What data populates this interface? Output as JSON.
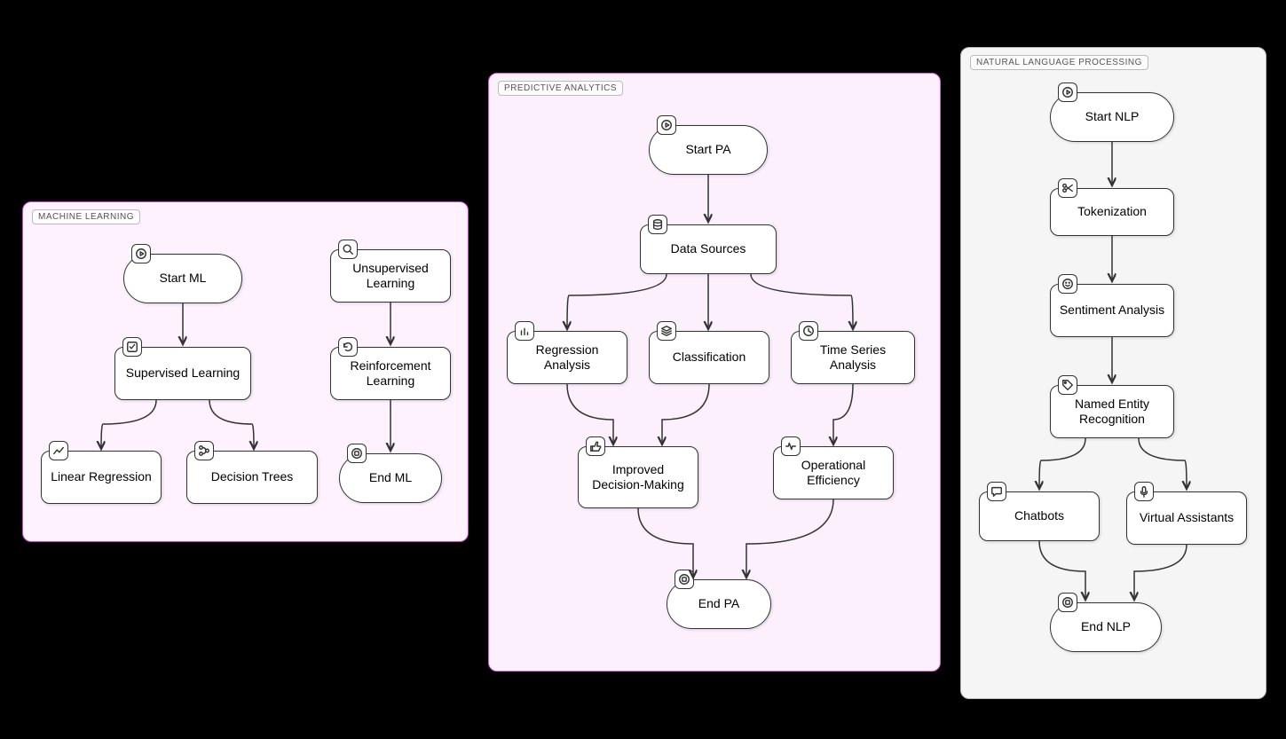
{
  "groups": {
    "ml": {
      "label": "MACHINE LEARNING"
    },
    "pa": {
      "label": "PREDICTIVE ANALYTICS"
    },
    "nlp": {
      "label": "NATURAL LANGUAGE PROCESSING"
    }
  },
  "nodes": {
    "ml_start": "Start ML",
    "ml_supervised": "Supervised Learning",
    "ml_unsupervised": "Unsupervised Learning",
    "ml_reinforcement": "Reinforcement Learning",
    "ml_linreg": "Linear Regression",
    "ml_dtrees": "Decision Trees",
    "ml_end": "End ML",
    "pa_start": "Start PA",
    "pa_sources": "Data Sources",
    "pa_regression": "Regression Analysis",
    "pa_classification": "Classification",
    "pa_timeseries": "Time Series Analysis",
    "pa_decision": "Improved Decision-Making",
    "pa_efficiency": "Operational Efficiency",
    "pa_end": "End PA",
    "nlp_start": "Start NLP",
    "nlp_token": "Tokenization",
    "nlp_sentiment": "Sentiment Analysis",
    "nlp_ner": "Named Entity Recognition",
    "nlp_chatbots": "Chatbots",
    "nlp_va": "Virtual Assistants",
    "nlp_end": "End NLP"
  },
  "icons": {
    "play": "play-icon",
    "stop": "stop-icon",
    "check": "check-icon",
    "search": "search-icon",
    "refresh": "refresh-icon",
    "chart": "chart-icon",
    "branch": "branch-icon",
    "db": "db-icon",
    "bars": "bars-icon",
    "layers": "layers-icon",
    "clock": "clock-icon",
    "thumbs": "thumbs-icon",
    "pulse": "pulse-icon",
    "scissors": "scissors-icon",
    "smile": "smile-icon",
    "tag": "tag-icon",
    "chat": "chat-icon",
    "mic": "mic-icon"
  },
  "diagram": {
    "groups": [
      {
        "id": "ml",
        "nodes": [
          "ml_start",
          "ml_supervised",
          "ml_unsupervised",
          "ml_reinforcement",
          "ml_linreg",
          "ml_dtrees",
          "ml_end"
        ]
      },
      {
        "id": "pa",
        "nodes": [
          "pa_start",
          "pa_sources",
          "pa_regression",
          "pa_classification",
          "pa_timeseries",
          "pa_decision",
          "pa_efficiency",
          "pa_end"
        ]
      },
      {
        "id": "nlp",
        "nodes": [
          "nlp_start",
          "nlp_token",
          "nlp_sentiment",
          "nlp_ner",
          "nlp_chatbots",
          "nlp_va",
          "nlp_end"
        ]
      }
    ],
    "edges": [
      [
        "ml_start",
        "ml_supervised"
      ],
      [
        "ml_supervised",
        "ml_linreg"
      ],
      [
        "ml_supervised",
        "ml_dtrees"
      ],
      [
        "ml_unsupervised",
        "ml_reinforcement"
      ],
      [
        "ml_reinforcement",
        "ml_end"
      ],
      [
        "pa_start",
        "pa_sources"
      ],
      [
        "pa_sources",
        "pa_regression"
      ],
      [
        "pa_sources",
        "pa_classification"
      ],
      [
        "pa_sources",
        "pa_timeseries"
      ],
      [
        "pa_regression",
        "pa_decision"
      ],
      [
        "pa_classification",
        "pa_decision"
      ],
      [
        "pa_timeseries",
        "pa_efficiency"
      ],
      [
        "pa_decision",
        "pa_end"
      ],
      [
        "pa_efficiency",
        "pa_end"
      ],
      [
        "nlp_start",
        "nlp_token"
      ],
      [
        "nlp_token",
        "nlp_sentiment"
      ],
      [
        "nlp_sentiment",
        "nlp_ner"
      ],
      [
        "nlp_ner",
        "nlp_chatbots"
      ],
      [
        "nlp_ner",
        "nlp_va"
      ],
      [
        "nlp_chatbots",
        "nlp_end"
      ],
      [
        "nlp_va",
        "nlp_end"
      ]
    ]
  }
}
